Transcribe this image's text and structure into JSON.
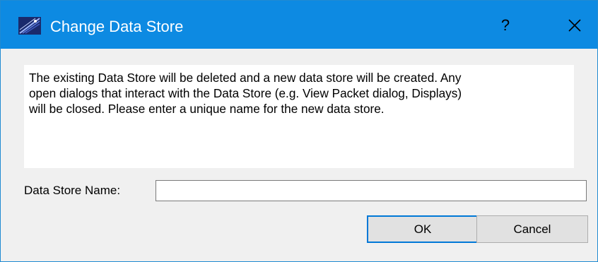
{
  "window": {
    "title": "Change Data Store",
    "help_glyph": "?",
    "icons": {
      "app": "app-logo-icon",
      "close": "close-icon"
    }
  },
  "message": "The existing Data Store will be deleted and a new data store will be created.  Any\nopen dialogs that interact with the Data Store (e.g. View Packet dialog, Displays)\nwill be closed. Please enter a unique name for the new data store.",
  "form": {
    "name_label": "Data Store Name:",
    "name_value": ""
  },
  "buttons": {
    "ok": "OK",
    "cancel": "Cancel"
  },
  "colors": {
    "titlebar": "#0d8ae2",
    "dialog_bg": "#f0f0f0",
    "default_button_border": "#0078d7"
  }
}
